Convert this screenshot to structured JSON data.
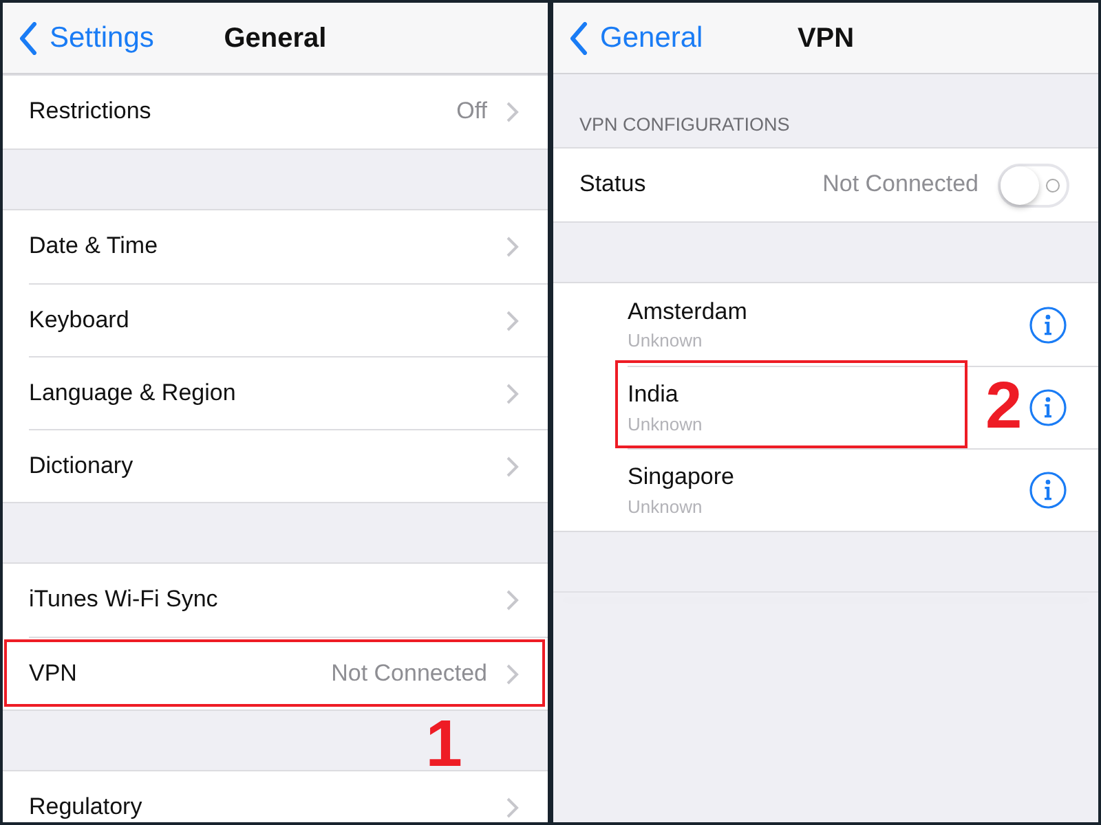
{
  "panels": [
    {
      "back_label": "Settings",
      "title": "General",
      "groups": [
        {
          "rows": [
            {
              "kind": "disclosure",
              "label": "Restrictions",
              "value": "Off"
            }
          ]
        },
        {
          "rows": [
            {
              "kind": "disclosure",
              "label": "Date & Time"
            },
            {
              "kind": "disclosure",
              "label": "Keyboard"
            },
            {
              "kind": "disclosure",
              "label": "Language & Region"
            },
            {
              "kind": "disclosure",
              "label": "Dictionary"
            }
          ]
        },
        {
          "rows": [
            {
              "kind": "disclosure",
              "label": "iTunes Wi-Fi Sync"
            },
            {
              "kind": "disclosure",
              "label": "VPN",
              "value": "Not Connected",
              "callout": "1"
            }
          ]
        },
        {
          "rows": [
            {
              "kind": "disclosure",
              "label": "Regulatory"
            }
          ]
        }
      ]
    },
    {
      "back_label": "General",
      "title": "VPN",
      "groups": [
        {
          "header": "VPN CONFIGURATIONS",
          "rows": [
            {
              "kind": "toggle",
              "label": "Status",
              "value": "Not Connected",
              "on": false
            }
          ]
        },
        {
          "rows": [
            {
              "kind": "configuration",
              "label": "Amsterdam",
              "detail": "Unknown"
            },
            {
              "kind": "configuration",
              "label": "India",
              "detail": "Unknown",
              "callout": "2"
            },
            {
              "kind": "configuration",
              "label": "Singapore",
              "detail": "Unknown"
            }
          ]
        }
      ]
    }
  ]
}
